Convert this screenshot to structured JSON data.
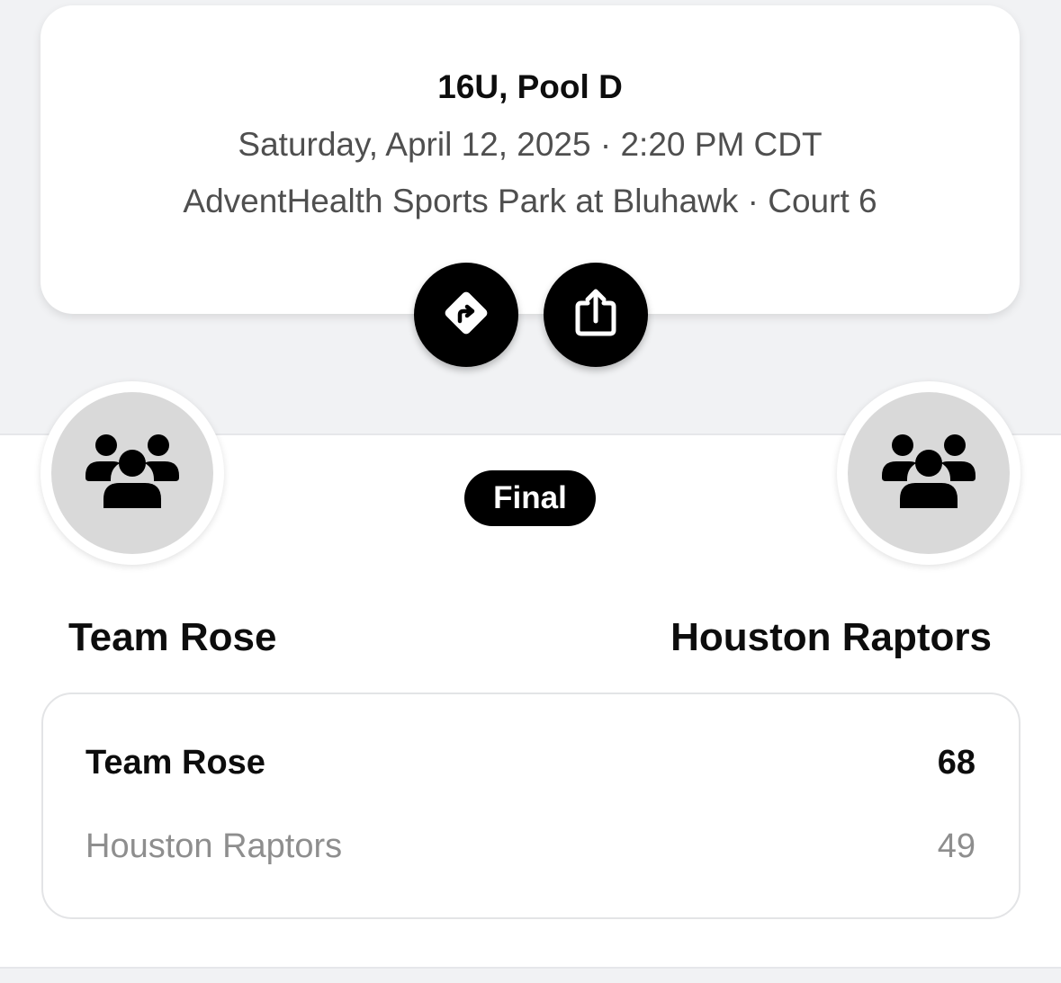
{
  "game": {
    "division_pool": "16U, Pool D",
    "datetime": "Saturday, April 12, 2025 · 2:20 PM CDT",
    "location": "AdventHealth Sports Park at Bluhawk · Court 6",
    "status": "Final"
  },
  "actions": {
    "directions_icon": "directions-sign-icon",
    "share_icon": "share-icon"
  },
  "teams": {
    "home": {
      "name": "Team Rose",
      "avatar_icon": "team-group-icon"
    },
    "away": {
      "name": "Houston Raptors",
      "avatar_icon": "team-group-icon"
    }
  },
  "scores": [
    {
      "team": "Team Rose",
      "score": "68",
      "winner": true
    },
    {
      "team": "Houston Raptors",
      "score": "49",
      "winner": false
    }
  ],
  "colors": {
    "background_band": "#f1f2f4",
    "card": "#ffffff",
    "accent": "#000000",
    "secondary_text": "#4f4f4f",
    "muted_text": "#8e8e8e",
    "avatar_fill": "#d9d9d9"
  }
}
